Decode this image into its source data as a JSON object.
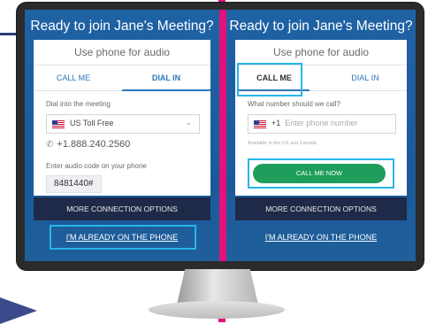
{
  "left_panel": {
    "title": "Ready to join Jane's Meeting?",
    "use_phone": "Use phone for audio",
    "tab_call_me": "CALL ME",
    "tab_dial_in": "DIAL IN",
    "dial_into_label": "Dial into the meeting",
    "country_option": "US Toll Free",
    "phone_number": "+1.888.240.2560",
    "audio_code_label": "Enter audio code on your phone",
    "audio_code": "8481440#",
    "more_options": "MORE CONNECTION OPTIONS",
    "already_on_phone": "I'M ALREADY ON THE PHONE"
  },
  "right_panel": {
    "title": "Ready to join Jane's Meeting?",
    "use_phone": "Use phone for audio",
    "tab_call_me": "CALL ME",
    "tab_dial_in": "DIAL IN",
    "question": "What number should we call?",
    "country_code": "+1",
    "phone_placeholder": "Enter phone number",
    "availability_note": "Available in the US and Canada",
    "call_button": "CALL ME NOW",
    "more_options": "MORE CONNECTION OPTIONS",
    "already_on_phone": "I'M ALREADY ON THE PHONE"
  },
  "colors": {
    "panel_blue": "#1d5fa0",
    "divider_pink": "#e4117a",
    "highlight_cyan": "#27b6e8",
    "button_green": "#1e9e5a",
    "dark_bar": "#1f2a48"
  }
}
